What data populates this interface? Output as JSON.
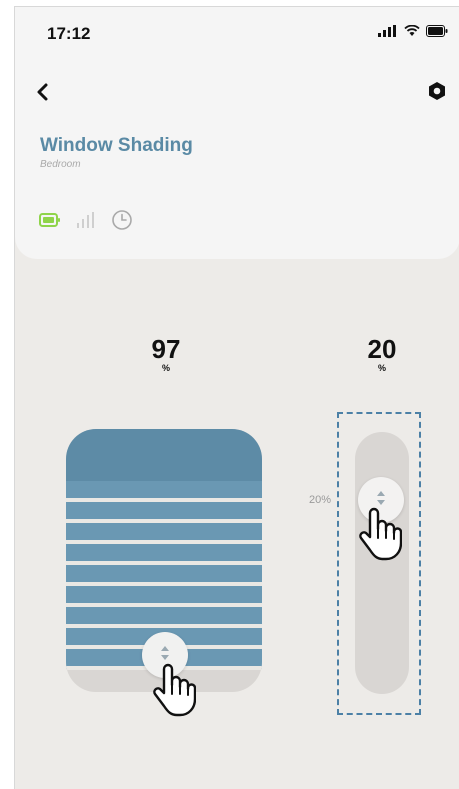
{
  "status_bar": {
    "time": "17:12"
  },
  "header": {
    "title": "Window Shading",
    "subtitle": "Bedroom"
  },
  "device_status_icons": [
    "battery-icon",
    "signal-icon",
    "clock-icon"
  ],
  "shade": {
    "position_value": "97",
    "position_unit": "%"
  },
  "tilt": {
    "value": "20",
    "unit": "%",
    "track_label": "20%"
  },
  "colors": {
    "accent": "#5a8aa5",
    "battery_green": "#8fd44a",
    "dashed_frame": "#4c80a6"
  }
}
